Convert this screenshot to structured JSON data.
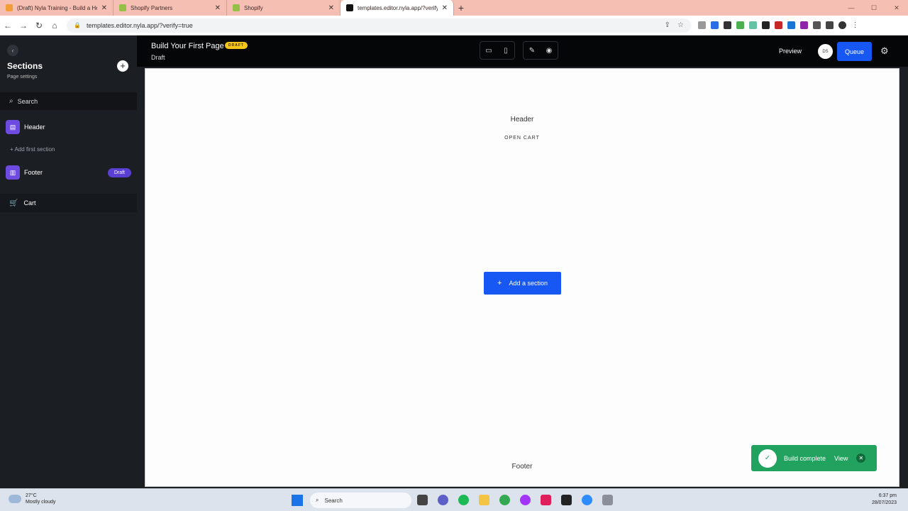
{
  "browser": {
    "tabs": [
      {
        "label": "(Draft) Nyla Training - Build a He",
        "active": false,
        "favicon_color": "#f29d38"
      },
      {
        "label": "Shopify Partners",
        "active": false,
        "favicon_color": "#95bf47"
      },
      {
        "label": "Shopify",
        "active": false,
        "favicon_color": "#95bf47"
      },
      {
        "label": "templates.editor.nyla.app/?verify",
        "active": true,
        "favicon_color": "#111111"
      }
    ],
    "new_tab": "+",
    "url": "templates.editor.nyla.app/?verify=true"
  },
  "app": {
    "page_title": "Build Your First Page",
    "draft_pill": "DRAFT",
    "subtitle": "Draft",
    "preview_label": "Preview",
    "avatar_initials": "DS",
    "queue_label": "Queue"
  },
  "sidebar": {
    "title": "Sections",
    "page_settings": "Page settings",
    "search_label": "Search",
    "items": [
      {
        "label": "Header"
      },
      {
        "label": "Add first section"
      },
      {
        "label": "Footer",
        "badge": "Draft"
      }
    ],
    "cart_label": "Cart"
  },
  "canvas": {
    "header_text": "Header",
    "open_cart": "OPEN CART",
    "add_section_label": "Add a section",
    "footer_text": "Footer"
  },
  "toast": {
    "message": "Build complete",
    "action": "View"
  },
  "taskbar": {
    "temperature": "27°C",
    "weather": "Mostly cloudy",
    "search": "Search",
    "time": "6:37 pm",
    "date": "28/07/2023"
  },
  "colors": {
    "accent": "#1758f4",
    "section_icon": "#6d4be0",
    "toast": "#21a35f",
    "draft_pill": "#f5c518"
  }
}
